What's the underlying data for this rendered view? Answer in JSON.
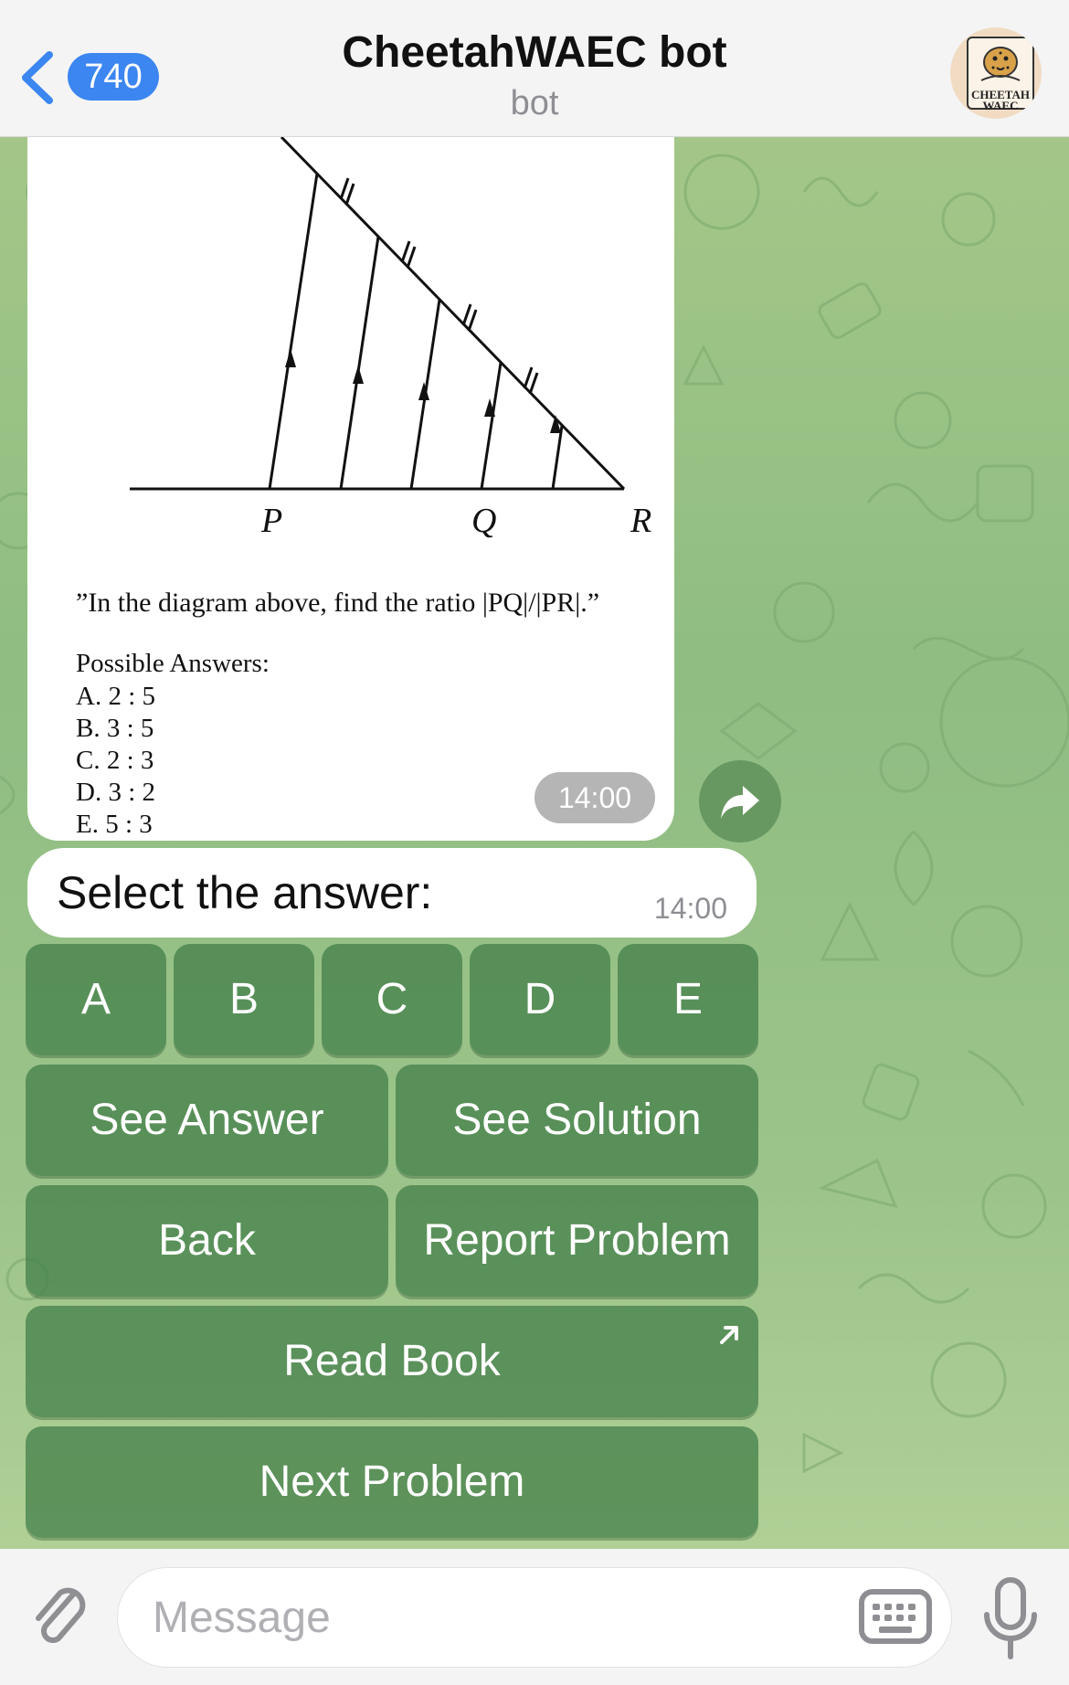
{
  "header": {
    "back_count": "740",
    "title": "CheetahWAEC bot",
    "subtitle": "bot",
    "avatar_text_line1": "CHEETAH",
    "avatar_text_line2": "WAEC"
  },
  "message": {
    "diagram_labels": {
      "p": "P",
      "q": "Q",
      "r": "R"
    },
    "question": "”In the diagram above, find the ratio |PQ|/|PR|.”",
    "answers_title": "Possible Answers:",
    "answers": [
      "A. 2 : 5",
      "B. 3 : 5",
      "C. 2 : 3",
      "D. 3 : 2",
      "E. 5 : 3"
    ],
    "time": "14:00"
  },
  "prompt": {
    "text": "Select the answer:",
    "time": "14:00"
  },
  "keyboard": {
    "options": [
      "A",
      "B",
      "C",
      "D",
      "E"
    ],
    "see_answer": "See Answer",
    "see_solution": "See Solution",
    "back": "Back",
    "report_problem": "Report Problem",
    "read_book": "Read Book",
    "next_problem": "Next Problem"
  },
  "composer": {
    "placeholder": "Message"
  },
  "icons": {
    "back": "chevron-left-icon",
    "share": "forward-arrow-icon",
    "attach": "paperclip-icon",
    "keyboard": "keyboard-icon",
    "mic": "microphone-icon",
    "external": "external-link-icon"
  },
  "colors": {
    "accent": "#3b86f0",
    "button": "#4f8a55",
    "bubble": "#ffffff",
    "background": "#9cc48a"
  }
}
